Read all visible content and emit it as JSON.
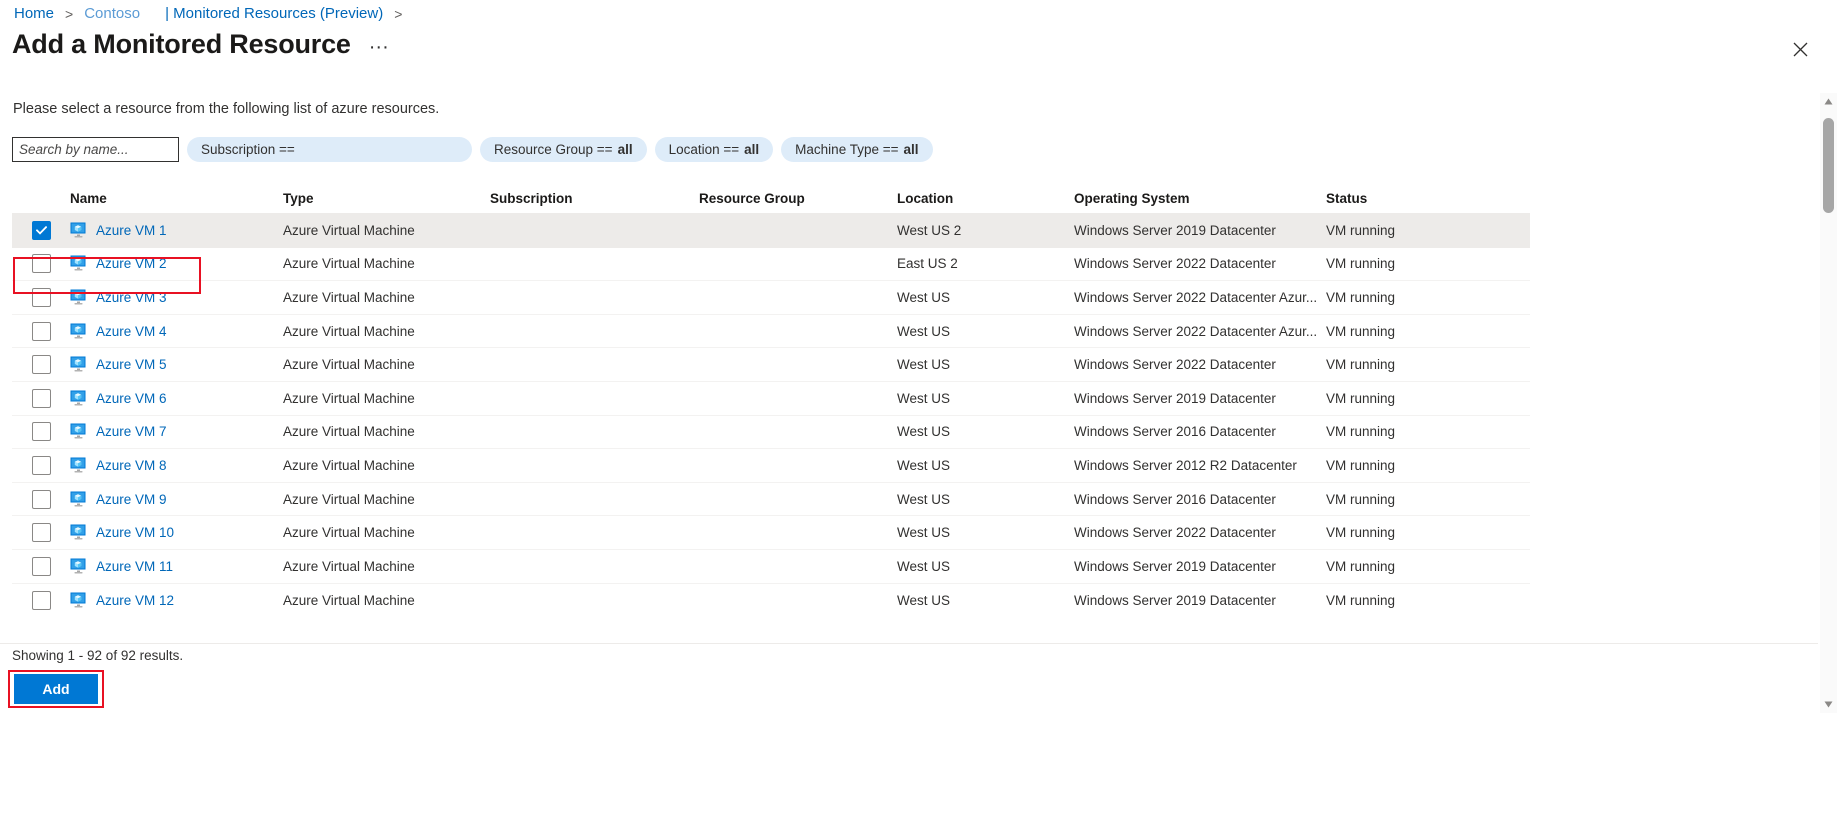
{
  "breadcrumb": {
    "home": "Home",
    "contoso": "Contoso",
    "monitored": "| Monitored Resources (Preview)",
    "separator": ">"
  },
  "header": {
    "title": "Add a Monitored Resource",
    "more_label": "···",
    "close_icon": "close-icon"
  },
  "instruction": "Please select a resource from the following list of azure resources.",
  "filters": {
    "search_placeholder": "Search by name...",
    "search_value": "",
    "pills": [
      {
        "label": "Subscription ==",
        "value": ""
      },
      {
        "label": "Resource Group ==",
        "value": "all"
      },
      {
        "label": "Location ==",
        "value": "all"
      },
      {
        "label": "Machine Type ==",
        "value": "all"
      }
    ]
  },
  "table": {
    "columns": [
      "Name",
      "Type",
      "Subscription",
      "Resource Group",
      "Location",
      "Operating System",
      "Status"
    ],
    "rows": [
      {
        "name": "Azure VM 1",
        "type": "Azure Virtual Machine",
        "subscription": "",
        "resource_group": "",
        "location": "West US 2",
        "os": "Windows Server 2019 Datacenter",
        "status": "VM running",
        "selected": true
      },
      {
        "name": "Azure VM 2",
        "type": "Azure Virtual Machine",
        "subscription": "",
        "resource_group": "",
        "location": "East US 2",
        "os": "Windows Server 2022 Datacenter",
        "status": "VM running",
        "selected": false
      },
      {
        "name": "Azure VM 3",
        "type": "Azure Virtual Machine",
        "subscription": "",
        "resource_group": "",
        "location": "West US",
        "os": "Windows Server 2022 Datacenter Azur...",
        "status": "VM running",
        "selected": false
      },
      {
        "name": "Azure VM 4",
        "type": "Azure Virtual Machine",
        "subscription": "",
        "resource_group": "",
        "location": "West US",
        "os": "Windows Server 2022 Datacenter Azur...",
        "status": "VM running",
        "selected": false
      },
      {
        "name": "Azure VM 5",
        "type": "Azure Virtual Machine",
        "subscription": "",
        "resource_group": "",
        "location": "West US",
        "os": "Windows Server 2022 Datacenter",
        "status": "VM running",
        "selected": false
      },
      {
        "name": "Azure VM 6",
        "type": "Azure Virtual Machine",
        "subscription": "",
        "resource_group": "",
        "location": "West US",
        "os": "Windows Server 2019 Datacenter",
        "status": "VM running",
        "selected": false
      },
      {
        "name": "Azure VM 7",
        "type": "Azure Virtual Machine",
        "subscription": "",
        "resource_group": "",
        "location": "West US",
        "os": "Windows Server 2016 Datacenter",
        "status": "VM running",
        "selected": false
      },
      {
        "name": "Azure VM 8",
        "type": "Azure Virtual Machine",
        "subscription": "",
        "resource_group": "",
        "location": "West US",
        "os": "Windows Server 2012 R2 Datacenter",
        "status": "VM running",
        "selected": false
      },
      {
        "name": "Azure VM 9",
        "type": "Azure Virtual Machine",
        "subscription": "",
        "resource_group": "",
        "location": "West US",
        "os": "Windows Server 2016 Datacenter",
        "status": "VM running",
        "selected": false
      },
      {
        "name": "Azure VM 10",
        "type": "Azure Virtual Machine",
        "subscription": "",
        "resource_group": "",
        "location": "West US",
        "os": "Windows Server 2022 Datacenter",
        "status": "VM running",
        "selected": false
      },
      {
        "name": "Azure VM 11",
        "type": "Azure Virtual Machine",
        "subscription": "",
        "resource_group": "",
        "location": "West US",
        "os": "Windows Server 2019 Datacenter",
        "status": "VM running",
        "selected": false
      },
      {
        "name": "Azure VM 12",
        "type": "Azure Virtual Machine",
        "subscription": "",
        "resource_group": "",
        "location": "West US",
        "os": "Windows Server 2019 Datacenter",
        "status": "VM running",
        "selected": false
      }
    ]
  },
  "footer": {
    "showing": "Showing 1 - 92 of 92 results.",
    "add_label": "Add"
  },
  "colors": {
    "link": "#0067b8",
    "accent": "#0078d4",
    "pill_bg": "#deecf9",
    "selected_row": "#edebe9",
    "annotation": "#e81123"
  }
}
